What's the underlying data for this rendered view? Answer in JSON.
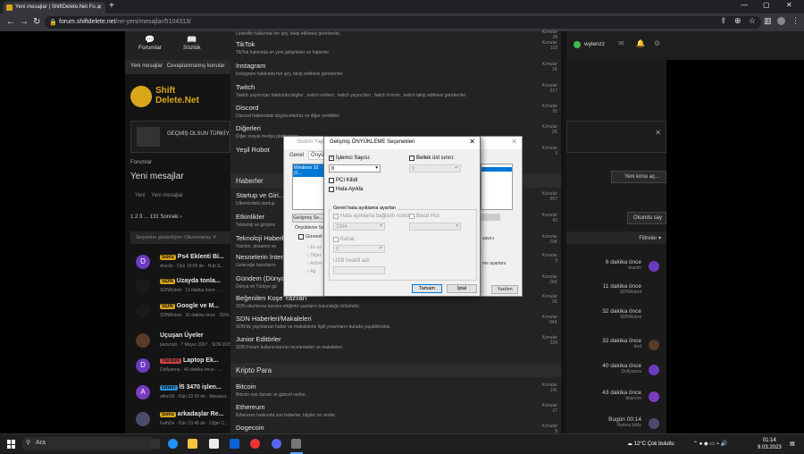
{
  "browser": {
    "tab_title": "Yeni mesajlar | ShiftDelete.Net Fo...",
    "url_host": "forum.shiftdelete.net",
    "url_path": "/ne-yeni/mesajlar/5104313/"
  },
  "forum": {
    "nav_forumlar": "Forumlar",
    "nav_sozluk": "Sözlük",
    "sub_new": "Yeni mesajlar",
    "sub_unanswered": "Cevaplanmamış konular",
    "user": "wylenzz",
    "banner": "GEÇMİŞ OLSUN TÜRKİY...",
    "breadcrumb": "Forumlar",
    "page_title": "Yeni mesajlar",
    "filter_new": "Yeni",
    "filter_posts": "Yeni mesajlar",
    "pages": "1  2  3  ...  131   Sonraki ›",
    "shown": "Seçmeler gösteriliyor:  Okunmamış ✕",
    "new_thread": "Yeni konu aç...",
    "read_btn": "Okundu say",
    "filters": "Filtreler ▾"
  },
  "menu": {
    "items": [
      {
        "title": "",
        "desc": "LinkedIn hakkında her şey, takip edilmesi gerekenler.",
        "count": "Konular\n28"
      },
      {
        "title": "TikTok",
        "desc": "TikTok hakkında en yeni gelişmeler ve haberler.",
        "count": "Konular\n118"
      },
      {
        "title": "Instagram",
        "desc": "Instagram hakkında her şey, takip edilmesi gerekenler.",
        "count": "Konular\n1K"
      },
      {
        "title": "Twitch",
        "desc": "Twitch yayıncıları hakkında bilgiler , twitch rehberi , twitch yayıncıları , twitch Forum , twitch takip edilmesi gerekenler.",
        "count": "Konular\n217"
      },
      {
        "title": "Discord",
        "desc": "Discord hakkındaki düşünceleriniz ve diğer yenilikler.",
        "count": "Konular\n91"
      },
      {
        "title": "Diğerleri",
        "desc": "Diğer sosyal medya platformları",
        "count": "Konular\n2K"
      },
      {
        "title": "Yeşil Robot",
        "desc": "",
        "count": "Konular\n3"
      }
    ],
    "section_news": "Haberler",
    "news": [
      {
        "title": "Startup ve Giri...",
        "desc": "Ülkemizdeki startup",
        "count": "Konular\n557"
      },
      {
        "title": "Etkinlikler",
        "desc": "Teknoloji ve girişimc",
        "count": "Konular\n60"
      },
      {
        "title": "Teknoloji Haberl...",
        "desc": "Yazılım, donanım ve",
        "count": "Konular\n20K"
      },
      {
        "title": "Nesnelerin İnter...",
        "desc": "Geleceğe hazırlanın",
        "count": "Konular\n9"
      },
      {
        "title": "Gündem (Dünya...",
        "desc": "Dünya ve Türkiye gü",
        "count": "Konular\n26K"
      },
      {
        "title": "Beğenilen Koşe Yazıları",
        "desc": "SDN okurlarına tavsiye ettiğimiz yazıların bulunduğu bölümdür.",
        "count": "Konular\n2K"
      },
      {
        "title": "SDN Haberleri/Makaleleri",
        "desc": "SDN'de yayınlanan haber ve makalelerle ilgili yorumların burada yapabilirsiniz.",
        "count": "Konular\n84K"
      },
      {
        "title": "Junior Editörler",
        "desc": "SDN Forum kullanıcılarının incelemeleri ve makaleleri.",
        "count": "Konular\n228"
      }
    ],
    "section_crypto": "Kripto Para",
    "crypto": [
      {
        "title": "Bitcoin",
        "desc": "Bitcoin son durum ve güncel veriler.",
        "count": "Konular\n141"
      },
      {
        "title": "Ethereum",
        "desc": "Ethereum hakkında son haberler, bilgiler ve veriler.",
        "count": "Konular\n27"
      },
      {
        "title": "Dogecoin",
        "desc": "Dogecoin hakkında son haberler, bilgiler ve veriler.",
        "count": "Konular\n9"
      }
    ]
  },
  "threads": [
    {
      "tag": "Soru",
      "tag_color": "#d9a61b",
      "title": "Ps4 Eklenti Bi...",
      "meta": "dracilo · Dün 19:05 de · Hub S...",
      "time": "6 dakika önce",
      "user": "dracilo",
      "av": "#6a3bbf",
      "avl": "D"
    },
    {
      "tag": "SDN",
      "tag_color": "#d9a61b",
      "title": "Uzayda tonla...",
      "meta": "SDNRobot · 11 dakika önce · ...",
      "time": "11 dakika önce",
      "user": "SDNRobot",
      "av": "#1a1a1a",
      "avl": ""
    },
    {
      "tag": "SDN",
      "tag_color": "#d9a61b",
      "title": "Google ve M...",
      "meta": "SDNRobot · 32 dakika önce · SDN...",
      "time": "32 dakika önce",
      "user": "SDNRobot",
      "av": "#1a1a1a",
      "avl": ""
    },
    {
      "tag": "",
      "tag_color": "",
      "title": "Uçuşan Üyeler",
      "meta": "pezenuit · 7 Mayıs 2007 · SDN DOS...",
      "time": "32 dakika önce",
      "user": "bud",
      "av": "#5a3a2a",
      "avl": ""
    },
    {
      "tag": "Yardım",
      "tag_color": "#c44",
      "title": "Laptop Ek...",
      "meta": "Dolfyanna · 40 dakika önce · ...",
      "time": "40 dakika önce",
      "user": "Dolfyanna",
      "av": "#6a3bbf",
      "avl": "D"
    },
    {
      "tag": "Öneri",
      "tag_color": "#2a8fd0",
      "title": "İ5 3470 işlen...",
      "meta": "afion16 · Dün 22:43 de · Masaüst...",
      "time": "43 dakika önce",
      "user": "bilanom",
      "av": "#7a3bbf",
      "avl": "A"
    },
    {
      "tag": "Soru",
      "tag_color": "#d9a61b",
      "title": "arkadaşlar Re...",
      "meta": "FathDe · Dün 23:48 de · Diğer C...",
      "time": "Bugün 00:14",
      "user": "Hamza.tsbly",
      "av": "#4a4a6a",
      "avl": ""
    }
  ],
  "dialog_bg": {
    "title": "Sistem Yapıl...",
    "tab_general": "Genel",
    "tab_boot": "Önyükleme",
    "list_item": "Windows 10 (C...",
    "adv_btn": "Gelişmiş Se...",
    "boot_opts": "Önyükleme Se...",
    "safe": "Güvenli ö...",
    "min": "En az",
    "other": "Diğer",
    "active": "Active",
    "net": "Ağ",
    "apply_btn": "Yardım",
    "right_text1": "şayıcı",
    "right_text2": "lerini kalıcı olarak",
    "right_text3": "me ayarlanı"
  },
  "dialog": {
    "title": "Gelişmiş ÖNYÜKLEME Seçenekleri",
    "proc_label": "İşlemci Sayısı:",
    "proc_value": "8",
    "mem_label": "Bellek üst sınırı:",
    "mem_value": "0",
    "pci": "PCI Kilidi",
    "debug": "Hata Ayıkla",
    "group": "Genel hata ayıklama ayarları",
    "debug_port": "Hata ayıklama bağlantı noktası:",
    "port_value": "1394",
    "baud": "Baud Hızı",
    "channel": "Kanal:",
    "channel_value": "0",
    "usb": "USB hedefi adı:",
    "ok": "Tamam",
    "cancel": "İptal"
  },
  "taskbar": {
    "search": "Ara",
    "weather": "12°C  Çok bulutlu",
    "time": "01:14",
    "date": "9.03.2023"
  }
}
